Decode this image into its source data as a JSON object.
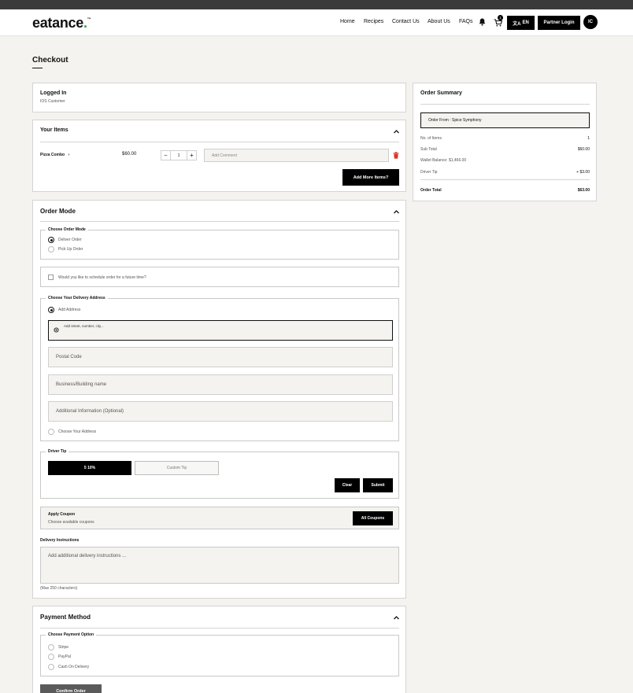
{
  "header": {
    "logo_text": "eatance",
    "logo_dot": ".",
    "logo_tm": "™",
    "nav": [
      "Home",
      "Recipes",
      "Contact Us",
      "About Us",
      "FAQs"
    ],
    "cart_count": "1",
    "language": "EN",
    "partner_login": "Partner Login",
    "avatar_initials": "IC"
  },
  "page": {
    "title": "Checkout"
  },
  "logged_in": {
    "title": "Logged In",
    "subtitle": "IOS Customer"
  },
  "your_items": {
    "title": "Your Items",
    "item_name": "Pizza Combo",
    "item_chevron": "›",
    "price": "$60.00",
    "quantity": "1",
    "minus": "–",
    "plus": "+",
    "comment_placeholder": "Add Comment",
    "add_more": "Add More Items?"
  },
  "order_mode": {
    "title": "Order Mode",
    "choose_label": "Choose Order Mode",
    "options": [
      "Deliver Order",
      "Pick Up Order"
    ],
    "schedule_label": "Would you like to schedule order for a future time?",
    "address_label": "Choose Your Delivery Address",
    "add_address": "Add Address",
    "street_placeholder": "Add street, number, city...",
    "postal_placeholder": "Postal Code",
    "building_placeholder": "Business/Building name",
    "additional_placeholder": "Additional Information (Optional)",
    "choose_address": "Choose Your Address",
    "driver_tip_label": "Driver Tip",
    "tip_selected": "5 10%",
    "custom_tip": "Custom Tip",
    "clear": "Clear",
    "submit": "Submit",
    "coupon_title": "Apply Coupon",
    "coupon_sub": "Choose available coupons",
    "all_coupons": "All Coupons",
    "delivery_instructions_label": "Delivery Instructions",
    "delivery_instructions_placeholder": "Add additional delivery instructions ...",
    "max_chars": "(Max 250 characters)"
  },
  "payment": {
    "title": "Payment Method",
    "choose_label": "Choose Payment Option",
    "options": [
      "Stripe",
      "PayPal",
      "Cash On Delivery"
    ],
    "confirm": "Confirm Order"
  },
  "summary": {
    "title": "Order Summary",
    "order_from": "Order From : Spice Symphony",
    "rows": [
      {
        "label": "No. of Items",
        "value": "1"
      },
      {
        "label": "Sub Total",
        "value": "$60.00"
      },
      {
        "label": "Wallet Balance: $1,466.00",
        "value": ""
      },
      {
        "label": "Driver Tip",
        "value": "+ $3.00"
      }
    ],
    "total_label": "Order Total",
    "total_value": "$63.00"
  },
  "colors": {
    "accent_green": "#27a844",
    "black": "#000000",
    "page_bg": "#f4f3ef",
    "delete_red": "#d9342b"
  }
}
